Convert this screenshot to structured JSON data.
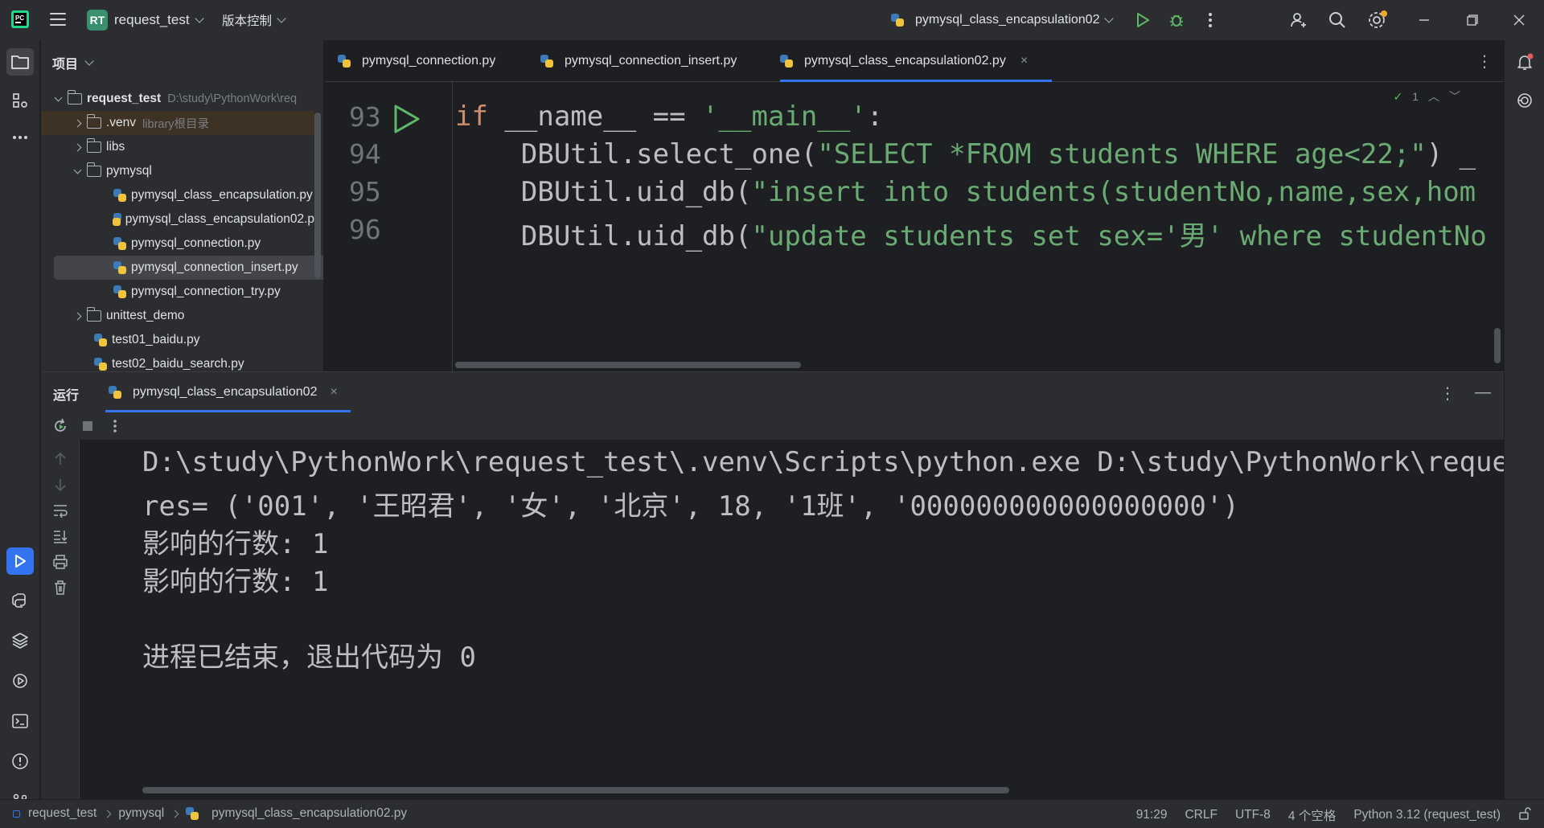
{
  "titlebar": {
    "project_badge": "RT",
    "project_name": "request_test",
    "vcs_label": "版本控制",
    "run_config": "pymysql_class_encapsulation02"
  },
  "project_panel": {
    "title": "项目",
    "root": {
      "name": "request_test",
      "path": "D:\\study\\PythonWork\\req"
    },
    "items": [
      {
        "label": ".venv",
        "note": "library根目录"
      },
      {
        "label": "libs"
      },
      {
        "label": "pymysql"
      },
      {
        "label": "pymysql_class_encapsulation.py"
      },
      {
        "label": "pymysql_class_encapsulation02.p"
      },
      {
        "label": "pymysql_connection.py"
      },
      {
        "label": "pymysql_connection_insert.py"
      },
      {
        "label": "pymysql_connection_try.py"
      },
      {
        "label": "unittest_demo"
      },
      {
        "label": "test01_baidu.py"
      },
      {
        "label": "test02_baidu_search.py"
      }
    ]
  },
  "editor": {
    "tabs": [
      {
        "label": "pymysql_connection.py"
      },
      {
        "label": "pymysql_connection_insert.py"
      },
      {
        "label": "pymysql_class_encapsulation02.py"
      }
    ],
    "hint_count": "1",
    "lines": [
      {
        "num": "93",
        "a": "if",
        "b": " __name__ == ",
        "c": "'__main__'",
        "d": ":"
      },
      {
        "num": "94",
        "a": "    DBUtil.select_one(",
        "b": "\"SELECT *FROM students WHERE age<22;\"",
        "c": ") _"
      },
      {
        "num": "95",
        "a": "    DBUtil.uid_db(",
        "b": "\"insert into students(studentNo,name,sex,hom"
      },
      {
        "num": "96",
        "a": "    DBUtil.uid_db(",
        "b": "\"update students set sex='男' where studentNo"
      }
    ]
  },
  "run_panel": {
    "title": "运行",
    "tab_label": "pymysql_class_encapsulation02",
    "output": [
      "D:\\study\\PythonWork\\request_test\\.venv\\Scripts\\python.exe D:\\study\\PythonWork\\reque",
      "res= ('001', '王昭君', '女', '北京', 18, '1班', '000000000000000000')",
      "影响的行数: 1",
      "影响的行数: 1",
      "",
      "进程已结束，退出代码为 0"
    ]
  },
  "statusbar": {
    "crumbs": [
      "request_test",
      "pymysql",
      "pymysql_class_encapsulation02.py"
    ],
    "position": "91:29",
    "line_sep": "CRLF",
    "encoding": "UTF-8",
    "indent": "4 个空格",
    "interpreter": "Python 3.12 (request_test)"
  },
  "colors": {
    "accent": "#3574f0",
    "keyword": "#cf8e6d",
    "string": "#6aab73",
    "run_green": "#5fb865"
  }
}
